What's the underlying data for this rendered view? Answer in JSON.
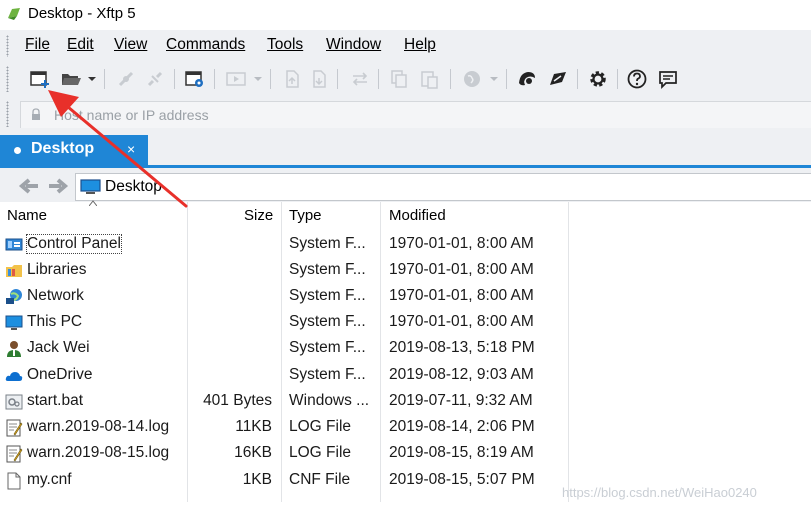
{
  "window": {
    "title": "Desktop - Xftp 5"
  },
  "menu": [
    "File",
    "Edit",
    "View",
    "Commands",
    "Tools",
    "Window",
    "Help"
  ],
  "address": {
    "placeholder": "Host name or IP address"
  },
  "tabs": [
    {
      "label": "Desktop",
      "close": "×"
    }
  ],
  "path": {
    "current": "Desktop"
  },
  "columns": {
    "name": "Name",
    "size": "Size",
    "type": "Type",
    "modified": "Modified"
  },
  "files": [
    {
      "name": "Control Panel",
      "size": "",
      "type": "System F...",
      "modified": "1970-01-01, 8:00 AM",
      "icon": "control-panel-icon"
    },
    {
      "name": "Libraries",
      "size": "",
      "type": "System F...",
      "modified": "1970-01-01, 8:00 AM",
      "icon": "libraries-icon"
    },
    {
      "name": "Network",
      "size": "",
      "type": "System F...",
      "modified": "1970-01-01, 8:00 AM",
      "icon": "network-icon"
    },
    {
      "name": "This PC",
      "size": "",
      "type": "System F...",
      "modified": "1970-01-01, 8:00 AM",
      "icon": "this-pc-icon"
    },
    {
      "name": "Jack Wei",
      "size": "",
      "type": "System F...",
      "modified": "2019-08-13, 5:18 PM",
      "icon": "user-folder-icon"
    },
    {
      "name": "OneDrive",
      "size": "",
      "type": "System F...",
      "modified": "2019-08-12, 9:03 AM",
      "icon": "onedrive-icon"
    },
    {
      "name": "start.bat",
      "size": "401 Bytes",
      "type": "Windows ...",
      "modified": "2019-07-11, 9:32 AM",
      "icon": "batch-file-icon"
    },
    {
      "name": "warn.2019-08-14.log",
      "size": "11KB",
      "type": "LOG File",
      "modified": "2019-08-14, 2:06 PM",
      "icon": "log-file-icon"
    },
    {
      "name": "warn.2019-08-15.log",
      "size": "16KB",
      "type": "LOG File",
      "modified": "2019-08-15, 8:19 AM",
      "icon": "log-file-icon"
    },
    {
      "name": "my.cnf",
      "size": "1KB",
      "type": "CNF File",
      "modified": "2019-08-15, 5:07 PM",
      "icon": "blank-file-icon"
    }
  ],
  "watermark": "https://blog.csdn.net/WeiHao0240",
  "colors": {
    "accent": "#1f86d6",
    "annotation_arrow": "#e8302a"
  }
}
